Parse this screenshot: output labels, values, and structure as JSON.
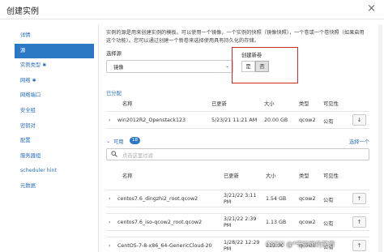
{
  "dialog": {
    "title": "创建实例",
    "close": "×"
  },
  "sidebar": {
    "items": [
      {
        "label": "详情",
        "required": "",
        "active": false
      },
      {
        "label": "源",
        "required": "",
        "active": true
      },
      {
        "label": "实例类型",
        "required": "✱",
        "active": false
      },
      {
        "label": "网络",
        "required": "✱",
        "active": false
      },
      {
        "label": "网络端口",
        "required": "",
        "active": false
      },
      {
        "label": "安全组",
        "required": "",
        "active": false
      },
      {
        "label": "密钥对",
        "required": "",
        "active": false
      },
      {
        "label": "配置",
        "required": "",
        "active": false
      },
      {
        "label": "服务器组",
        "required": "",
        "active": false
      },
      {
        "label": "scheduler hint",
        "required": "",
        "active": false
      },
      {
        "label": "元数据",
        "required": "",
        "active": false
      }
    ]
  },
  "source": {
    "description": "实例的源是用来创建实例的模板。可以使用一个镜像，一个实例的快照（镜像快照），一个卷或一个卷快照（如果启用这个功能）。您可以通过创建一个新卷来选择使用具有持久化的存储。",
    "select_label": "选择源",
    "select_value": "镜像",
    "caret": "⌄",
    "new_volume_label": "创建新卷",
    "yes": "是",
    "no": "否",
    "selected": "否"
  },
  "allocated": {
    "label": "已分配",
    "columns": [
      "名称",
      "已更新",
      "大小",
      "类型",
      "可见性"
    ],
    "rows": [
      {
        "name": "win2012R2_Openstack123",
        "updated": "5/23/21 11:21 AM",
        "size": "20.00 GB",
        "type": "qcow2",
        "visibility": "公有",
        "action": "↓"
      }
    ]
  },
  "available": {
    "label": "可用",
    "count": "18",
    "select_one": "选择一个",
    "filter_placeholder": "点击这里过滤",
    "columns": [
      "名称",
      "已更新",
      "大小",
      "类型",
      "可见性"
    ],
    "rows": [
      {
        "name": "centos7.6_dingzhi2_root.qcow2",
        "updated_l1": "3/21/22 3:11",
        "updated_l2": "PM",
        "size": "1.54 GB",
        "type": "qcow2",
        "visibility": "公有",
        "action": "↑"
      },
      {
        "name": "centos7.6_iso-qcow2_root.qcow2",
        "updated_l1": "3/21/22 2:39",
        "updated_l2": "PM",
        "size": "1.13 GB",
        "type": "qcow2",
        "visibility": "公有",
        "action": "↑"
      },
      {
        "name": "CentOS-7-8-x86_64-GenericCloud-20",
        "updated_l1": "1/28/22 12:29",
        "updated_l2": "PM",
        "size": "819.06",
        "type": "qcow2",
        "visibility": "公有",
        "action": "↑"
      }
    ]
  },
  "watermark": "CSDN @*守护她的笑容",
  "icons": {
    "chevron_right": "›",
    "chevron_down": "⌄",
    "search": "🔍"
  }
}
